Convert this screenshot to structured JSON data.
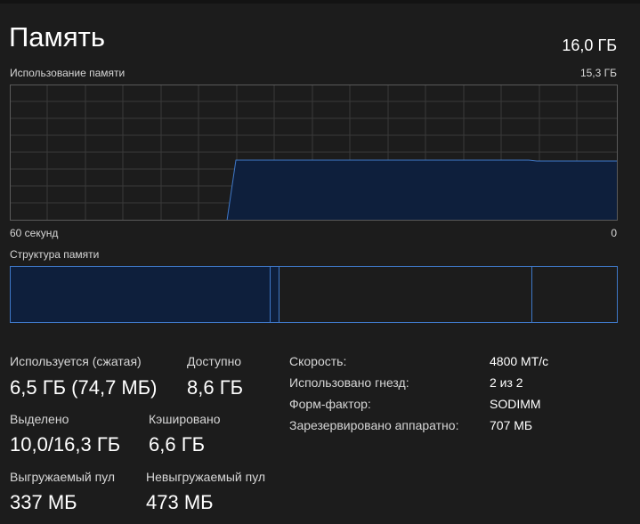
{
  "header": {
    "title": "Память",
    "total": "16,0 ГБ"
  },
  "usage_graph": {
    "label": "Использование памяти",
    "max_label": "15,3 ГБ",
    "left_axis_label": "60 секунд",
    "right_axis_label": "0",
    "colors": {
      "line": "#3f78c8",
      "fill": "#0e1f3c",
      "grid": "#3a3a3a",
      "border": "#3f78c8"
    }
  },
  "composition": {
    "label": "Структура памяти",
    "colors": {
      "in_use": "#0e1f3c",
      "border": "#3f78c8"
    }
  },
  "stats": {
    "in_use": {
      "label": "Используется (сжатая)",
      "value": "6,5 ГБ (74,7 МБ)"
    },
    "available": {
      "label": "Доступно",
      "value": "8,6 ГБ"
    },
    "committed": {
      "label": "Выделено",
      "value": "10,0/16,3 ГБ"
    },
    "cached": {
      "label": "Кэшировано",
      "value": "6,6 ГБ"
    },
    "paged_pool": {
      "label": "Выгружаемый пул",
      "value": "337 МБ"
    },
    "non_paged_pool": {
      "label": "Невыгружаемый пул",
      "value": "473 МБ"
    }
  },
  "details": [
    {
      "key": "Скорость:",
      "value": "4800 МТ/с"
    },
    {
      "key": "Использовано гнезд:",
      "value": "2 из 2"
    },
    {
      "key": "Форм-фактор:",
      "value": "SODIMM"
    },
    {
      "key": "Зарезервировано аппаратно:",
      "value": "707 МБ"
    }
  ]
}
